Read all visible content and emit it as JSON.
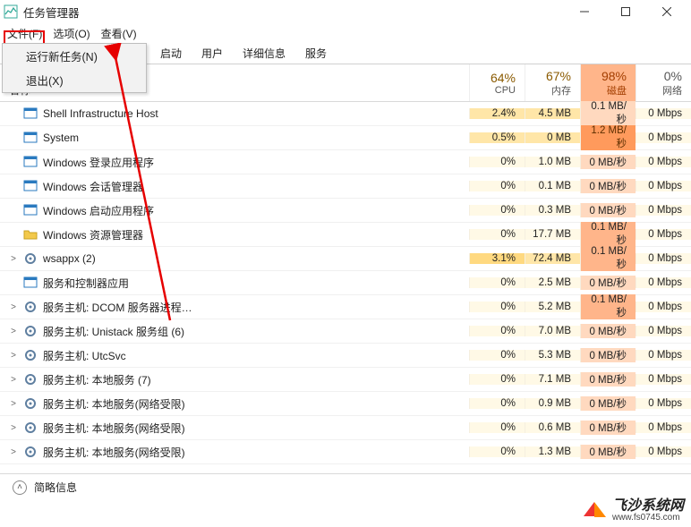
{
  "window": {
    "title": "任务管理器"
  },
  "menu": {
    "file": "文件(F)",
    "options": "选项(O)",
    "view": "查看(V)",
    "dropdown": {
      "new_task": "运行新任务(N)",
      "exit": "退出(X)"
    }
  },
  "tabs": {
    "startup": "启动",
    "users": "用户",
    "details": "详细信息",
    "services": "服务"
  },
  "table": {
    "header": {
      "name": "名称",
      "cols": [
        {
          "pct": "64%",
          "label": "CPU",
          "key": "cpu"
        },
        {
          "pct": "67%",
          "label": "内存",
          "key": "mem"
        },
        {
          "pct": "98%",
          "label": "磁盘",
          "key": "disk"
        },
        {
          "pct": "0%",
          "label": "网络",
          "key": "net"
        }
      ]
    },
    "rows": [
      {
        "exp": "",
        "icon": "app",
        "name": "Shell Infrastructure Host",
        "cpu": "2.4%",
        "mem": "4.5 MB",
        "disk": "0.1 MB/秒",
        "net": "0 Mbps",
        "top": true
      },
      {
        "exp": "",
        "icon": "app",
        "name": "System",
        "cpu": "0.5%",
        "mem": "0 MB",
        "disk": "1.2 MB/秒",
        "net": "0 Mbps",
        "top": true,
        "diskH": "h"
      },
      {
        "exp": "",
        "icon": "app",
        "name": "Windows 登录应用程序",
        "cpu": "0%",
        "mem": "1.0 MB",
        "disk": "0 MB/秒",
        "net": "0 Mbps"
      },
      {
        "exp": "",
        "icon": "app",
        "name": "Windows 会话管理器",
        "cpu": "0%",
        "mem": "0.1 MB",
        "disk": "0 MB/秒",
        "net": "0 Mbps"
      },
      {
        "exp": "",
        "icon": "app",
        "name": "Windows 启动应用程序",
        "cpu": "0%",
        "mem": "0.3 MB",
        "disk": "0 MB/秒",
        "net": "0 Mbps"
      },
      {
        "exp": "",
        "icon": "folder",
        "name": "Windows 资源管理器",
        "cpu": "0%",
        "mem": "17.7 MB",
        "disk": "0.1 MB/秒",
        "net": "0 Mbps",
        "diskH": "m"
      },
      {
        "exp": ">",
        "icon": "gear",
        "name": "wsappx (2)",
        "cpu": "3.1%",
        "mem": "72.4 MB",
        "disk": "0.1 MB/秒",
        "net": "0 Mbps",
        "cpuH": "h2",
        "memH": "h1",
        "diskH": "m"
      },
      {
        "exp": "",
        "icon": "app",
        "name": "服务和控制器应用",
        "cpu": "0%",
        "mem": "2.5 MB",
        "disk": "0 MB/秒",
        "net": "0 Mbps"
      },
      {
        "exp": ">",
        "icon": "gear",
        "name": "服务主机: DCOM 服务器进程…",
        "cpu": "0%",
        "mem": "5.2 MB",
        "disk": "0.1 MB/秒",
        "net": "0 Mbps",
        "diskH": "m"
      },
      {
        "exp": ">",
        "icon": "gear",
        "name": "服务主机: Unistack 服务组 (6)",
        "cpu": "0%",
        "mem": "7.0 MB",
        "disk": "0 MB/秒",
        "net": "0 Mbps"
      },
      {
        "exp": ">",
        "icon": "gear",
        "name": "服务主机: UtcSvc",
        "cpu": "0%",
        "mem": "5.3 MB",
        "disk": "0 MB/秒",
        "net": "0 Mbps"
      },
      {
        "exp": ">",
        "icon": "gear",
        "name": "服务主机: 本地服务 (7)",
        "cpu": "0%",
        "mem": "7.1 MB",
        "disk": "0 MB/秒",
        "net": "0 Mbps"
      },
      {
        "exp": ">",
        "icon": "gear",
        "name": "服务主机: 本地服务(网络受限)",
        "cpu": "0%",
        "mem": "0.9 MB",
        "disk": "0 MB/秒",
        "net": "0 Mbps"
      },
      {
        "exp": ">",
        "icon": "gear",
        "name": "服务主机: 本地服务(网络受限)",
        "cpu": "0%",
        "mem": "0.6 MB",
        "disk": "0 MB/秒",
        "net": "0 Mbps"
      },
      {
        "exp": ">",
        "icon": "gear",
        "name": "服务主机: 本地服务(网络受限)",
        "cpu": "0%",
        "mem": "1.3 MB",
        "disk": "0 MB/秒",
        "net": "0 Mbps"
      }
    ]
  },
  "footer": {
    "brief": "简略信息"
  },
  "watermark": {
    "name": "飞沙系统网",
    "url": "www.fs0745.com"
  }
}
